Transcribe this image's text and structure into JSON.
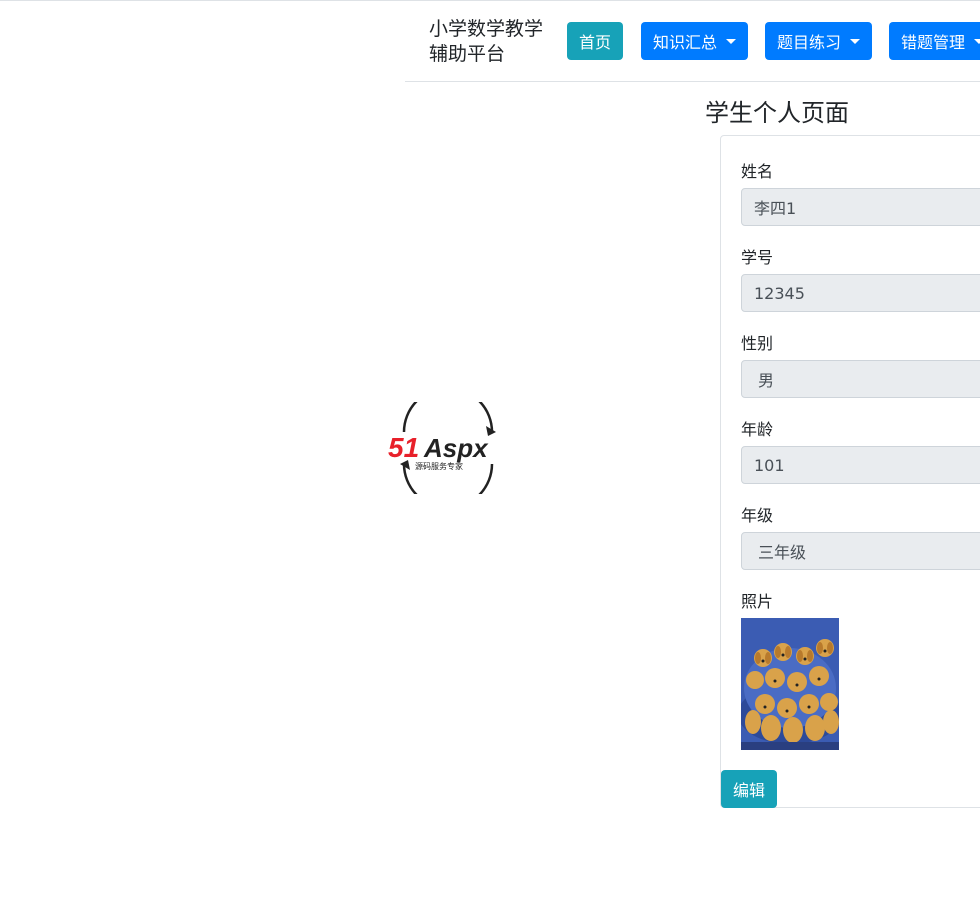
{
  "navbar": {
    "brand": "小学数学教学辅助平台",
    "home_label": "首页",
    "menus": [
      {
        "label": "知识汇总"
      },
      {
        "label": "题目练习"
      },
      {
        "label": "错题管理"
      }
    ]
  },
  "page": {
    "title": "学生个人页面"
  },
  "form": {
    "name": {
      "label": "姓名",
      "value": "李四1"
    },
    "student_id": {
      "label": "学号",
      "value": "12345"
    },
    "gender": {
      "label": "性别",
      "value": "男"
    },
    "age": {
      "label": "年龄",
      "value": "101"
    },
    "grade": {
      "label": "年级",
      "value": "三年级"
    },
    "photo": {
      "label": "照片"
    },
    "edit_label": "编辑"
  },
  "logo": {
    "brand_red": "51",
    "brand_rest": "Aspx",
    "tagline": "源码服务专家"
  },
  "colors": {
    "info": "#17a2b8",
    "primary": "#007bff",
    "input_bg": "#e9ecef",
    "logo_red": "#e8202a",
    "logo_green": "#3aa935"
  }
}
